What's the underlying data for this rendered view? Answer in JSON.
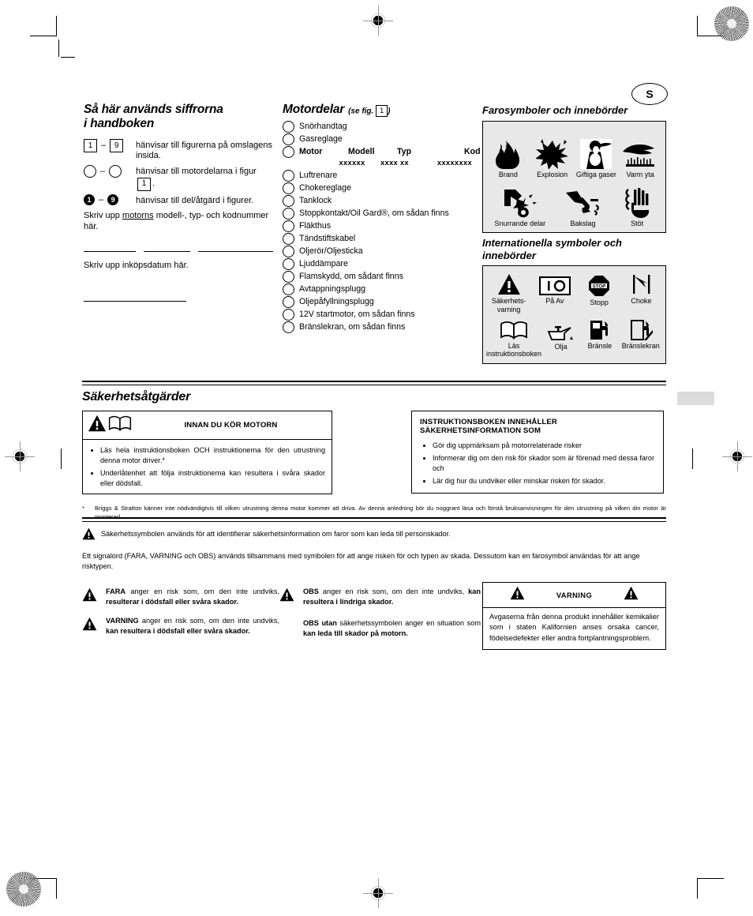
{
  "page": {
    "locale_badge": "S"
  },
  "numbering": {
    "title_line1": "Så här används siffrorna",
    "title_line2": "i handboken",
    "rows": [
      {
        "key_from": "1",
        "key_to": "9",
        "key_style": "box",
        "text": "hänvisar till figurerna på omslagens insida."
      },
      {
        "key_from": "",
        "key_to": "",
        "key_style": "circle",
        "text_before": "hänvisar till motordelarna i figur",
        "ref": "1",
        "text_after": "."
      },
      {
        "key_from": "1",
        "key_to": "9",
        "key_style": "filled",
        "text": "hänvisar till del/åtgärd i figurer."
      }
    ],
    "write_model": "Skriv upp motorns modell-, typ- och kodnummer här.",
    "write_model_underline": "motorns",
    "write_date": "Skriv upp inköpsdatum här."
  },
  "parts": {
    "title": "Motordelar",
    "title_note_before": "(se fig.",
    "title_note_ref": "1",
    "title_note_after": ")",
    "items_before_motor": [
      "Snörhandtag",
      "Gasreglage"
    ],
    "motor_row": {
      "label": "Motor",
      "columns": [
        "Modell",
        "Typ",
        "Kod"
      ],
      "values": [
        "xxxxxx",
        "xxxx xx",
        "xxxxxxxx"
      ]
    },
    "items_after_motor": [
      "Luftrenare",
      "Chokereglage",
      "Tanklock",
      "Stoppkontakt/Oil Gard®, om sådan finns",
      "Fläkthus",
      "Tändstiftskabel",
      "Oljerör/Oljesticka",
      "Ljuddämpare",
      "Flamskydd, om sådant finns",
      "Avtappningsplugg",
      "Oljepåfyllningsplugg",
      "12V startmotor, om sådan finns",
      "Bränslekran, om sådan finns"
    ]
  },
  "hazard_symbols": {
    "title": "Farosymboler och innebörder",
    "row1": [
      {
        "icon": "fire-icon",
        "label": "Brand"
      },
      {
        "icon": "explosion-icon",
        "label": "Explosion"
      },
      {
        "icon": "toxic-fumes-icon",
        "label": "Giftiga gaser"
      },
      {
        "icon": "hot-surface-icon",
        "label": "Varm yta"
      }
    ],
    "row2": [
      {
        "icon": "rotating-parts-icon",
        "label": "Snurrande delar"
      },
      {
        "icon": "kickback-icon",
        "label": "Bakslag"
      },
      {
        "icon": "electric-shock-icon",
        "label": "Stöt"
      }
    ]
  },
  "international_symbols": {
    "title_line1": "Internationella symboler och",
    "title_line2": "innebörder",
    "row1": [
      {
        "icon": "safety-alert-triangle-icon",
        "label": "Säkerhets-\nvarning"
      },
      {
        "icon": "on-off-icon",
        "label": "På Av"
      },
      {
        "icon": "stop-octagon-icon",
        "label": "Stopp"
      },
      {
        "icon": "choke-icon",
        "label": "Choke"
      }
    ],
    "row2": [
      {
        "icon": "open-book-icon",
        "label": "Läs\ninstruktionsboken"
      },
      {
        "icon": "oil-can-icon",
        "label": "Olja"
      },
      {
        "icon": "fuel-pump-icon",
        "label": "Bränsle"
      },
      {
        "icon": "fuel-shutoff-icon",
        "label": "Bränslekran"
      }
    ]
  },
  "safety": {
    "section_title": "Säkerhetsåtgärder",
    "left_box": {
      "heading": "INNAN DU KÖR MOTORN",
      "bullets": [
        "Läs hela instruktionsboken OCH instruktionerna för den utrustning denna motor driver.*",
        "Underlåtenhet att följa instruktionerna kan resultera i svåra skador eller dödsfall."
      ]
    },
    "right_box": {
      "heading": "INSTRUKTIONSBOKEN INNEHÅLLER SÄKERHETSINFORMATION SOM",
      "bullets": [
        "Gör dig uppmärksam på motorrelaterade risker",
        "Informerar dig om den risk för skador som är förenad med dessa faror och",
        "Lär dig hur du undviker eller minskar risken för skador."
      ]
    },
    "footnote_marker": "*",
    "footnote": "Briggs & Stratton känner inte nödvändigtvis till vilken utrustning denna motor kommer att driva. Av denna anledning bör du noggrant läsa och förstå bruksanvisningen för den utrustning på vilken din motor är monterad."
  },
  "signal_words": {
    "intro_symbol_text": "Säkerhetssymbolen används för att identifierar säkerhetsinformation om faror som kan leda till personskador.",
    "intro_text": "Ett signalord (FARA, VARNING och OBS) används tillsammans med symbolen för att ange risken för och typen av skada. Dessutom kan en farosymbol användas för att ange risktypen.",
    "definitions_left": [
      {
        "word": "FARA",
        "normal": " anger en risk som, om den inte undviks, ",
        "bold": "resulterar i dödsfall eller svåra skador."
      },
      {
        "word": "VARNING",
        "normal": " anger en risk som, om den inte undviks, ",
        "bold": "kan resultera i dödsfall eller svåra skador."
      }
    ],
    "definitions_right": [
      {
        "word": "OBS",
        "normal": " anger en risk som, om den inte undviks, ",
        "bold": "kan resultera i lindriga skador."
      },
      {
        "word": "OBS utan",
        "normal": " säkerhetssymbolen anger en situation som ",
        "bold": "kan leda till skador på motorn."
      }
    ],
    "california_box": {
      "heading": "VARNING",
      "body": "Avgaserna från denna produkt innehåller kemikalier som i staten Kalifornien anses orsaka cancer, födelsedefekter eller andra fortplantningsproblem."
    }
  }
}
